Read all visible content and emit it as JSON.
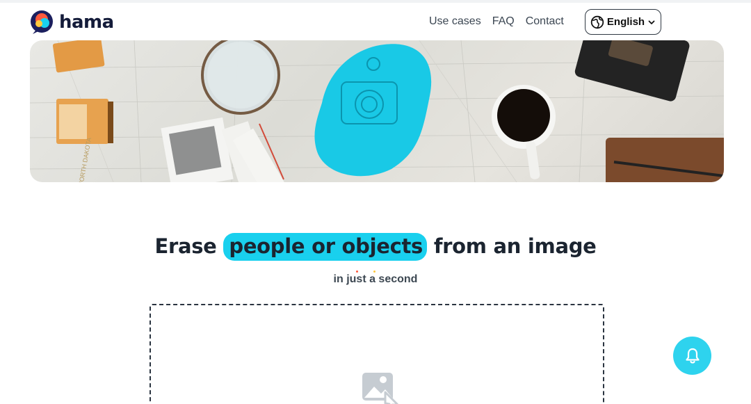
{
  "brand": {
    "name": "hama"
  },
  "nav": {
    "use_cases": "Use cases",
    "faq": "FAQ",
    "contact": "Contact"
  },
  "language": {
    "selected": "English"
  },
  "hero": {
    "alt": "Desk with camera, map and coffee; camera highlighted for erasing"
  },
  "headline": {
    "before": "Erase",
    "highlight": "people or objects",
    "after": "from an image"
  },
  "subheadline": "in just a second",
  "upload": {
    "icon": "image-upload-icon"
  },
  "fab": {
    "icon": "bell-icon"
  },
  "colors": {
    "accent": "#19d0ee",
    "fab": "#2ed3ee",
    "text": "#1b2430"
  }
}
